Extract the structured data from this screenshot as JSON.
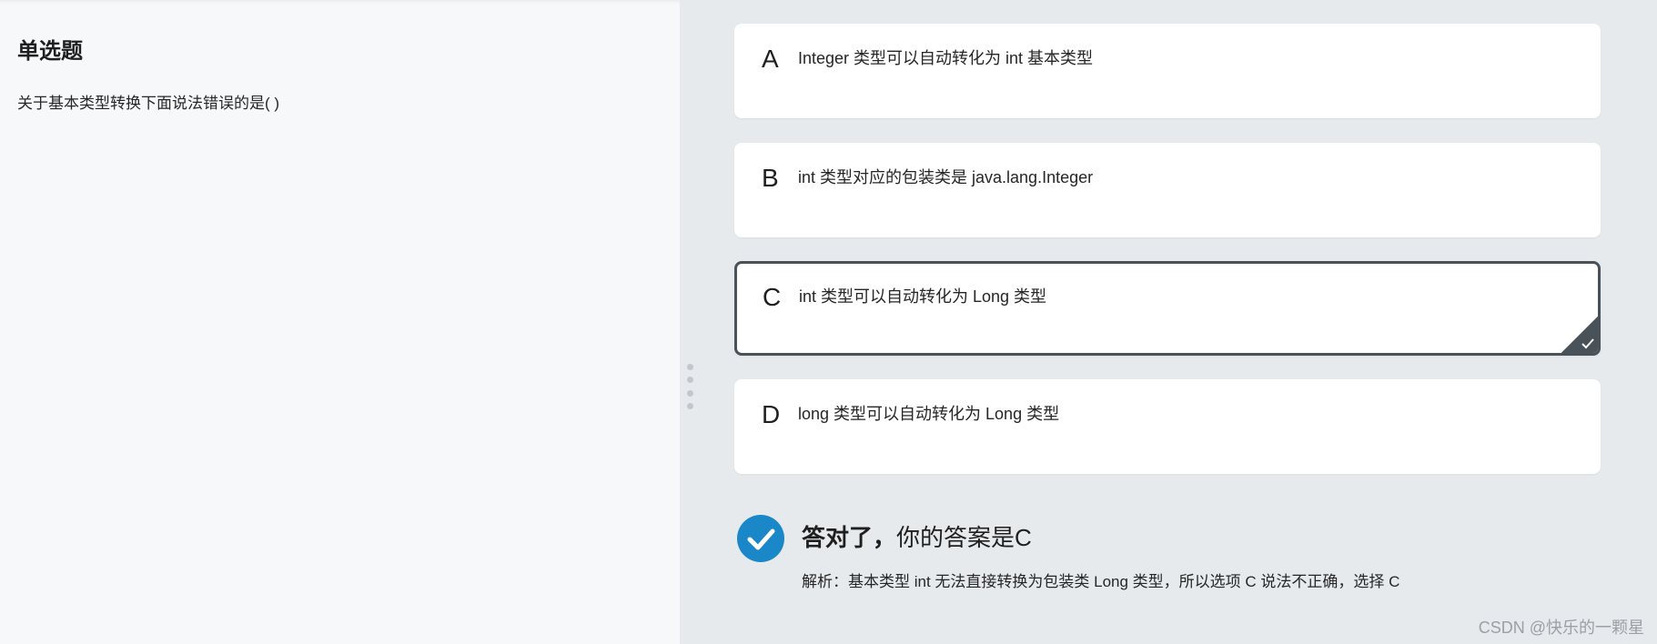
{
  "question": {
    "type_label": "单选题",
    "text": "关于基本类型转换下面说法错误的是( )"
  },
  "options": [
    {
      "letter": "A",
      "text": "Integer 类型可以自动转化为 int 基本类型",
      "selected": false
    },
    {
      "letter": "B",
      "text": "int 类型对应的包装类是 java.lang.Integer",
      "selected": false
    },
    {
      "letter": "C",
      "text": "int 类型可以自动转化为 Long 类型",
      "selected": true
    },
    {
      "letter": "D",
      "text": "long 类型可以自动转化为 Long 类型",
      "selected": false
    }
  ],
  "result": {
    "status": "答对了，",
    "answer_text": "你的答案是C",
    "analysis": "解析：基本类型 int 无法直接转换为包装类 Long 类型，所以选项 C 说法不正确，选择 C",
    "icon": "check-circle-icon"
  },
  "watermark": "CSDN @快乐的一颗星",
  "colors": {
    "left_bg": "#f7f8fa",
    "right_bg": "#e7eaed",
    "selected_border": "#4a5259",
    "correct_icon": "#1a87c8"
  }
}
